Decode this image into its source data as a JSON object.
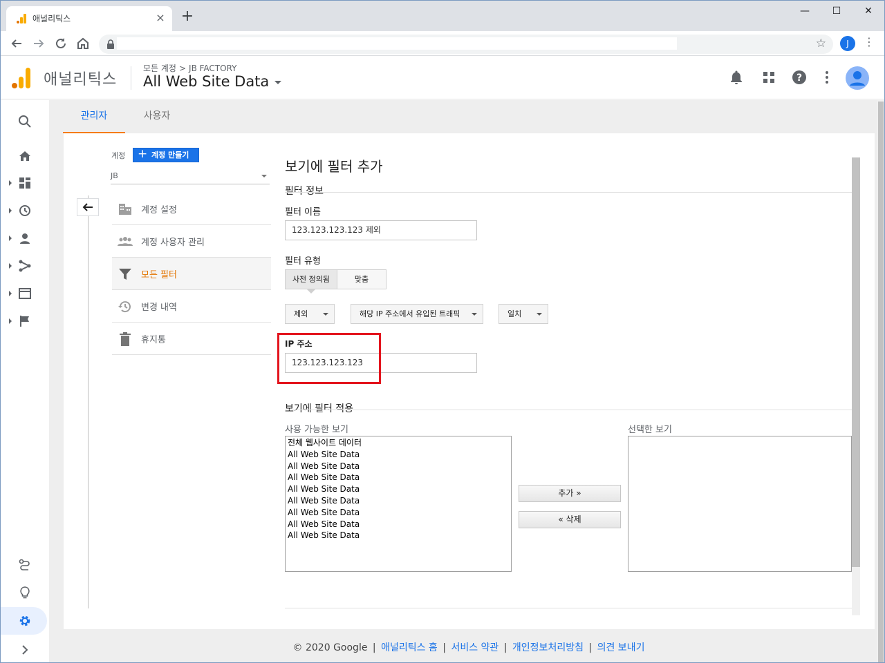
{
  "browser": {
    "tab_title": "애널리틱스",
    "tab_close": "×",
    "new_tab": "+",
    "avatar_letter": "J",
    "window_controls": [
      "—",
      "☐",
      "✕"
    ]
  },
  "header": {
    "brand": "애널리틱스",
    "breadcrumb": [
      "모든 계정",
      "JB FACTORY"
    ],
    "breadcrumb_sep": ">",
    "view_title": "All Web Site Data"
  },
  "admin_tabs": [
    {
      "label": "관리자",
      "active": true
    },
    {
      "label": "사용자",
      "active": false
    }
  ],
  "account": {
    "label": "계정",
    "create_button": "계정 만들기",
    "selected": "JB"
  },
  "menu": [
    {
      "label": "계정 설정",
      "icon": "building-icon"
    },
    {
      "label": "계정 사용자 관리",
      "icon": "people-icon"
    },
    {
      "label": "모든 필터",
      "icon": "filter-icon",
      "active": true
    },
    {
      "label": "변경 내역",
      "icon": "history-icon"
    },
    {
      "label": "휴지통",
      "icon": "trash-icon"
    }
  ],
  "form": {
    "title": "보기에 필터 추가",
    "section_info": "필터 정보",
    "filter_name_label": "필터 이름",
    "filter_name_value": "123.123.123.123 제외",
    "filter_type_label": "필터 유형",
    "type_predefined": "사전 정의됨",
    "type_custom": "맞춤",
    "dd_exclude": "제외",
    "dd_traffic": "해당 IP 주소에서 유입된 트래픽",
    "dd_match": "일치",
    "ip_label": "IP 주소",
    "ip_value": "123.123.123.123",
    "section_apply": "보기에 필터 적용",
    "available_label": "사용 가능한 보기",
    "selected_label": "선택한 보기",
    "available_views": [
      "전체 웹사이트 데이터",
      "All Web Site Data",
      "All Web Site Data",
      "All Web Site Data",
      "All Web Site Data",
      "All Web Site Data",
      "All Web Site Data",
      "All Web Site Data",
      "All Web Site Data"
    ],
    "add_button": "추가 »",
    "remove_button": "« 삭제"
  },
  "footer": {
    "copyright": "© 2020 Google",
    "links": [
      "애널리틱스 홈",
      "서비스 약관",
      "개인정보처리방침",
      "의견 보내기"
    ],
    "sep": "|"
  },
  "colors": {
    "accent": "#1a73e8",
    "active_menu": "#e37400",
    "highlight": "#e3141d"
  }
}
